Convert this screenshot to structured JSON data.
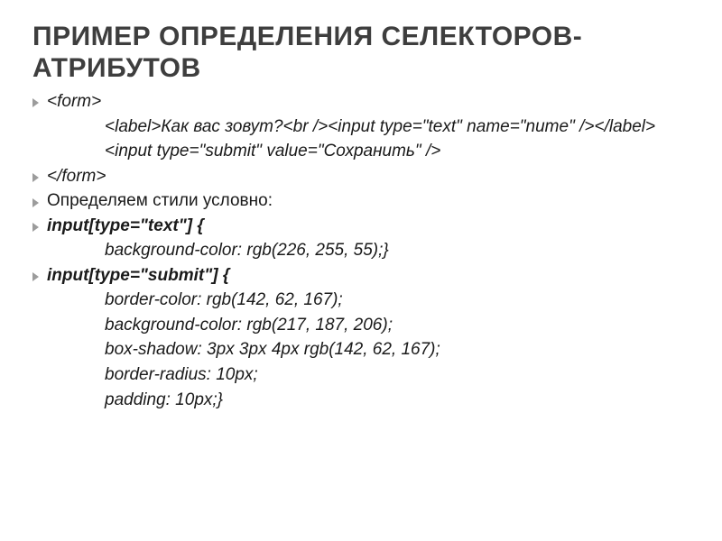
{
  "title": "ПРИМЕР ОПРЕДЕЛЕНИЯ СЕЛЕКТОРОВ-АТРИБУТОВ",
  "code": {
    "line1": "<form>",
    "line2": "<label>Как вас зовут?<br /><input type=\"text\" name=\"nume\" /></label>",
    "line3": "<input type=\"submit\" value=\"Сохранить\" />",
    "line4": "</form>"
  },
  "text": {
    "define": "Определяем стили условно:"
  },
  "css": {
    "sel1": "input[type=\"text\"] {",
    "sel1_rule1": "background-color: rgb(226, 255, 55);}",
    "sel2": "input[type=\"submit\"] {",
    "sel2_rule1": "border-color: rgb(142, 62, 167);",
    "sel2_rule2": "background-color: rgb(217, 187, 206);",
    "sel2_rule3": "box-shadow: 3px 3px 4px rgb(142, 62, 167);",
    "sel2_rule4": "border-radius: 10px;",
    "sel2_rule5": "padding: 10px;}"
  }
}
